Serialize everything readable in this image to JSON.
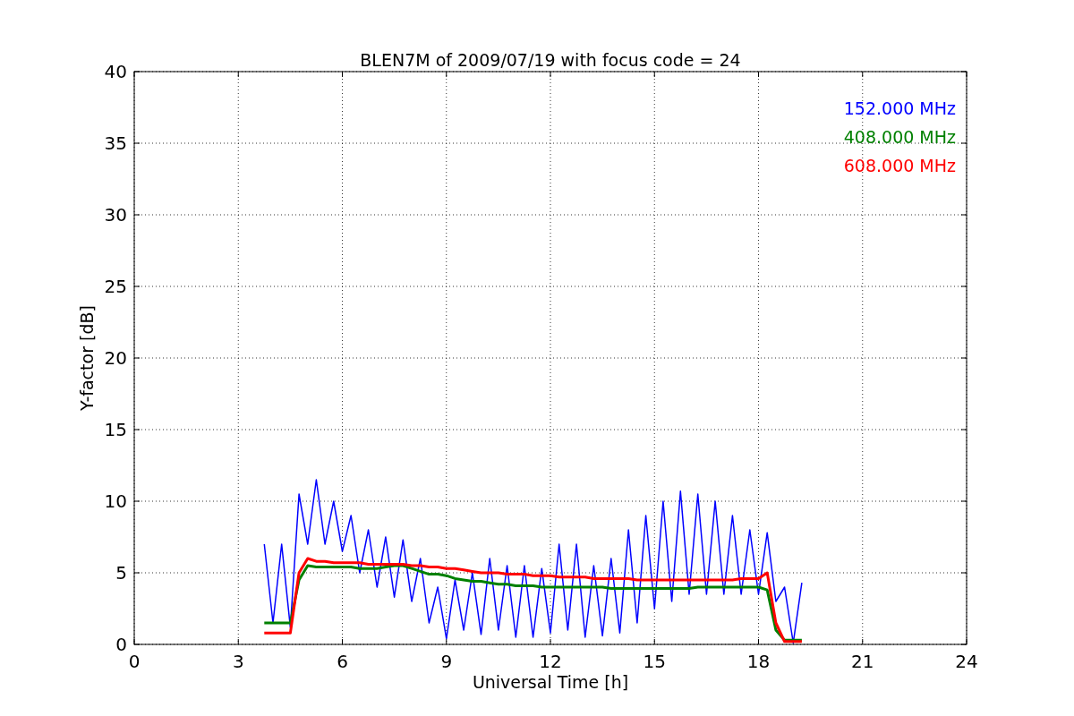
{
  "plot": {
    "chart_data": {
      "type": "line",
      "title": "BLEN7M of 2009/07/19 with focus code = 24",
      "xlabel": "Universal Time [h]",
      "ylabel": "Y-factor [dB]",
      "grid": true,
      "xlim": [
        0,
        24
      ],
      "ylim": [
        0,
        40
      ],
      "xticks": [
        0,
        3,
        6,
        9,
        12,
        15,
        18,
        21,
        24
      ],
      "yticks": [
        0,
        5,
        10,
        15,
        20,
        25,
        30,
        35,
        40
      ],
      "x": [
        3.75,
        4,
        4.25,
        4.5,
        4.75,
        5,
        5.25,
        5.5,
        5.75,
        6,
        6.25,
        6.5,
        6.75,
        7,
        7.25,
        7.5,
        7.75,
        8,
        8.25,
        8.5,
        8.75,
        9,
        9.25,
        9.5,
        9.75,
        10,
        10.25,
        10.5,
        10.75,
        11,
        11.25,
        11.5,
        11.75,
        12,
        12.25,
        12.5,
        12.75,
        13,
        13.25,
        13.5,
        13.75,
        14,
        14.25,
        14.5,
        14.75,
        15,
        15.25,
        15.5,
        15.75,
        16,
        16.25,
        16.5,
        16.75,
        17,
        17.25,
        17.5,
        17.75,
        18,
        18.25,
        18.5,
        18.75,
        19,
        19.25
      ],
      "series": [
        {
          "name": "152.000 MHz",
          "color": "#0000ff",
          "values": [
            7,
            1.5,
            7,
            1.2,
            10.5,
            7,
            11.5,
            7,
            10,
            6.5,
            9,
            5,
            8,
            4,
            7.5,
            3.3,
            7.3,
            3,
            6,
            1.5,
            4,
            0.4,
            4.5,
            1,
            5,
            0.7,
            6,
            1,
            5.5,
            0.5,
            5.5,
            0.5,
            5.3,
            0.8,
            7,
            1,
            7,
            0.5,
            5.5,
            0.6,
            6,
            0.8,
            8,
            1.5,
            9,
            2.5,
            10,
            3,
            10.7,
            3.5,
            10.5,
            3.5,
            10,
            3.5,
            9,
            3.5,
            8,
            3.5,
            7.8,
            3,
            4,
            0.1,
            4.3
          ]
        },
        {
          "name": "408.000 MHz",
          "color": "#008000",
          "values": [
            1.5,
            1.5,
            1.5,
            1.5,
            4.5,
            5.5,
            5.4,
            5.4,
            5.4,
            5.4,
            5.4,
            5.3,
            5.3,
            5.3,
            5.4,
            5.5,
            5.5,
            5.3,
            5.1,
            4.9,
            4.9,
            4.8,
            4.6,
            4.5,
            4.4,
            4.4,
            4.3,
            4.2,
            4.2,
            4.1,
            4.1,
            4.1,
            4.0,
            4.0,
            4.0,
            4.0,
            4.0,
            4.0,
            4.0,
            4.0,
            3.9,
            3.9,
            3.9,
            3.9,
            3.9,
            3.9,
            3.9,
            3.9,
            3.9,
            3.9,
            4.0,
            4.0,
            4.0,
            4.0,
            4.0,
            4.0,
            4.0,
            4.0,
            3.8,
            1.0,
            0.3,
            0.3,
            0.3
          ]
        },
        {
          "name": "608.000 MHz",
          "color": "#ff0000",
          "values": [
            0.8,
            0.8,
            0.8,
            0.8,
            5,
            6,
            5.8,
            5.8,
            5.7,
            5.7,
            5.7,
            5.7,
            5.6,
            5.6,
            5.6,
            5.6,
            5.6,
            5.5,
            5.5,
            5.4,
            5.4,
            5.3,
            5.3,
            5.2,
            5.1,
            5.0,
            5.0,
            5.0,
            4.9,
            4.9,
            4.9,
            4.8,
            4.8,
            4.8,
            4.7,
            4.7,
            4.7,
            4.7,
            4.6,
            4.6,
            4.6,
            4.6,
            4.6,
            4.5,
            4.5,
            4.5,
            4.5,
            4.5,
            4.5,
            4.5,
            4.5,
            4.5,
            4.5,
            4.5,
            4.5,
            4.6,
            4.6,
            4.6,
            5.0,
            1.5,
            0.2,
            0.2,
            0.2
          ]
        }
      ]
    }
  }
}
